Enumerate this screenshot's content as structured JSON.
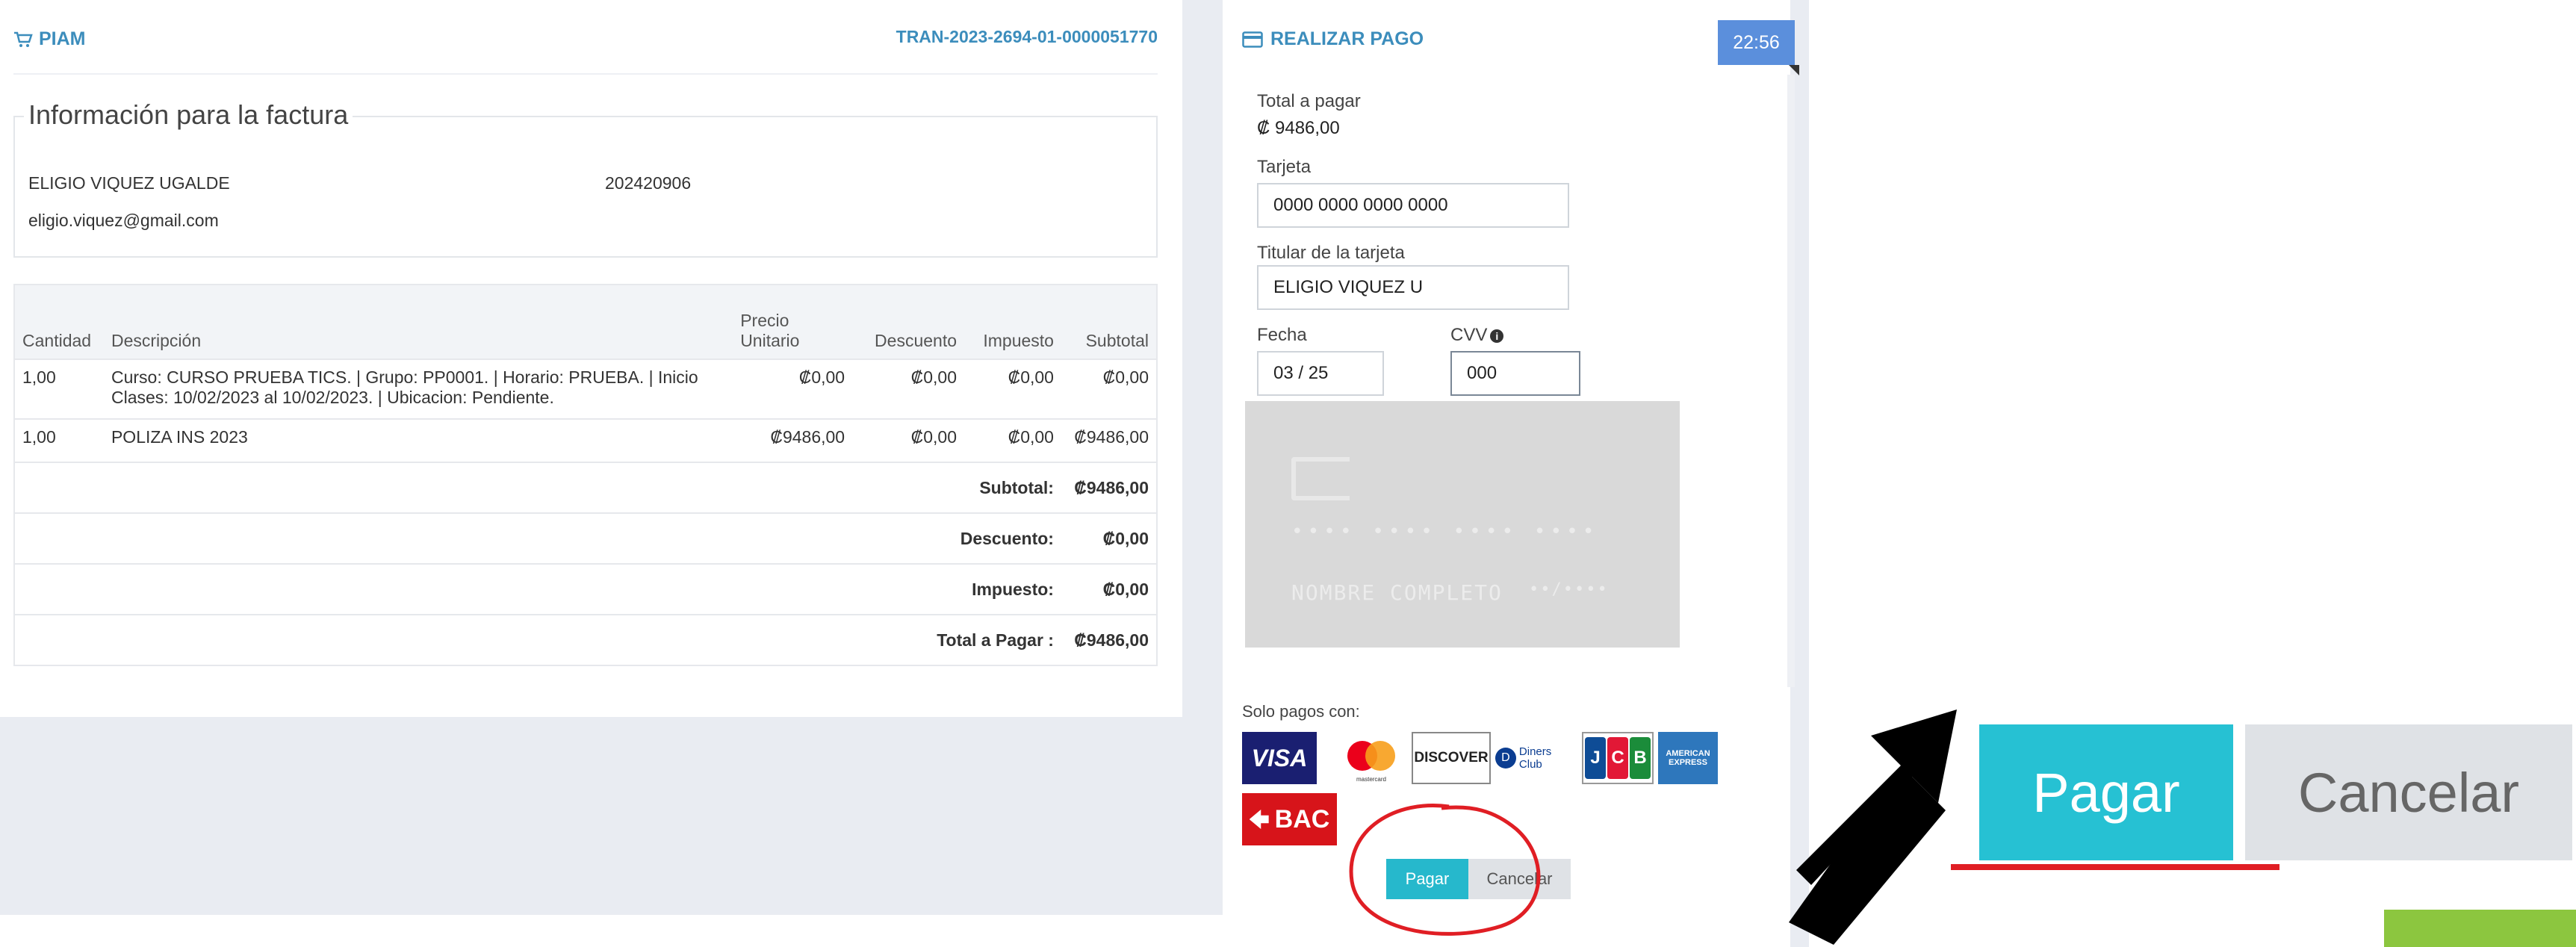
{
  "invoice": {
    "brand": "PIAM",
    "transaction_id": "TRAN-2023-2694-01-0000051770",
    "info_title": "Información para la factura",
    "customer_name": "ELIGIO VIQUEZ UGALDE",
    "customer_id": "202420906",
    "customer_email": "eligio.viquez@gmail.com",
    "columns": [
      "Cantidad",
      "Descripción",
      "Precio Unitario",
      "Descuento",
      "Impuesto",
      "Subtotal"
    ],
    "rows": [
      {
        "qty": "1,00",
        "desc": "Curso: CURSO PRUEBA TICS. | Grupo: PP0001. | Horario: PRUEBA. | Inicio Clases: 10/02/2023 al 10/02/2023. | Ubicacion: Pendiente.",
        "price": "₡0,00",
        "discount": "₡0,00",
        "tax": "₡0,00",
        "subtotal": "₡0,00"
      },
      {
        "qty": "1,00",
        "desc": "POLIZA INS 2023",
        "price": "₡9486,00",
        "discount": "₡0,00",
        "tax": "₡0,00",
        "subtotal": "₡9486,00"
      }
    ],
    "summary": {
      "subtotal_label": "Subtotal:",
      "subtotal_value": "₡9486,00",
      "discount_label": "Descuento:",
      "discount_value": "₡0,00",
      "tax_label": "Impuesto:",
      "tax_value": "₡0,00",
      "total_label": "Total a Pagar :",
      "total_value": "₡9486,00"
    }
  },
  "payment": {
    "title": "REALIZAR PAGO",
    "timer": "22:56",
    "total_label": "Total a pagar",
    "total_value": "₡ 9486,00",
    "card_label": "Tarjeta",
    "card_value": "0000 0000 0000 0000",
    "holder_label": "Titular de la tarjeta",
    "holder_value": "ELIGIO VIQUEZ U",
    "date_label": "Fecha",
    "date_value": "03 / 25",
    "cvv_label": "CVV",
    "cvv_value": "000",
    "card_preview": {
      "number": "•••• •••• •••• ••••",
      "name": "NOMBRE COMPLETO",
      "expiry": "••/••••"
    },
    "accepted_label": "Solo pagos con:",
    "brands": {
      "visa": "VISA",
      "mastercard": "mastercard",
      "discover": "DISCOVER",
      "diners": "Diners Club",
      "jcb": [
        "J",
        "C",
        "B"
      ],
      "amex": "AMERICAN EXPRESS",
      "bac": "BAC"
    },
    "pay_button": "Pagar",
    "cancel_button": "Cancelar"
  },
  "zoom": {
    "pay_button": "Pagar",
    "cancel_button": "Cancelar"
  },
  "colors": {
    "accent": "#3c8dbc",
    "pay": "#26b8cc",
    "cancel": "#dfe2e6",
    "timer": "#5b8fdc",
    "highlight": "#e01e24"
  }
}
